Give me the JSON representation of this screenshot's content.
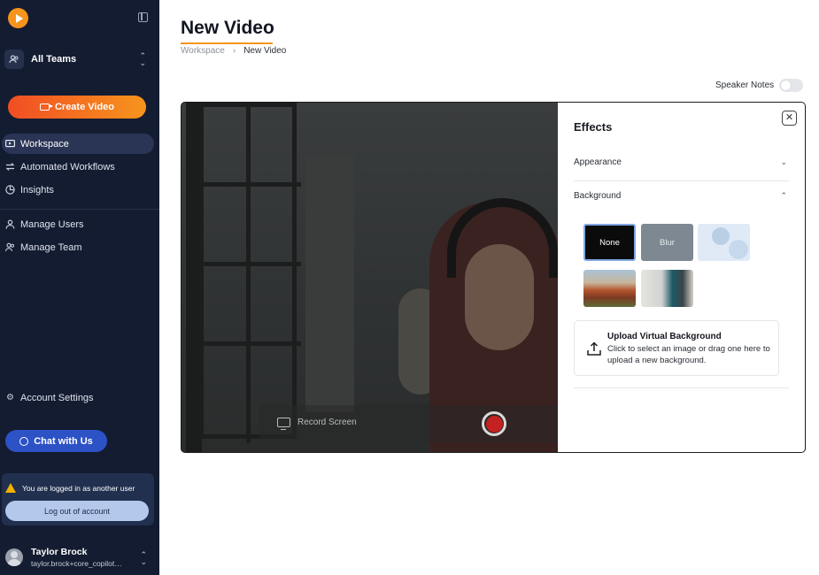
{
  "sidebar": {
    "team_selector": {
      "label": "All Teams"
    },
    "create_button": {
      "label": "Create Video"
    },
    "nav": [
      {
        "label": "Workspace",
        "icon": "workspace-icon",
        "active": true
      },
      {
        "label": "Automated Workflows",
        "icon": "workflow-icon",
        "active": false
      },
      {
        "label": "Insights",
        "icon": "insights-icon",
        "active": false
      },
      {
        "label": "Manage Users",
        "icon": "user-icon",
        "active": false
      },
      {
        "label": "Manage Team",
        "icon": "team-icon",
        "active": false
      }
    ],
    "account_settings": {
      "label": "Account Settings",
      "icon": "gear-icon"
    },
    "chat_button": {
      "label": "Chat with Us"
    },
    "warning": {
      "text": "You are logged in as another user",
      "logout_label": "Log out of account"
    },
    "user": {
      "name": "Taylor Brock",
      "email": "taylor.brock+core_copilot…"
    }
  },
  "main": {
    "title": "New Video",
    "breadcrumb": [
      "Workspace",
      "New Video"
    ],
    "speaker_notes": {
      "label": "Speaker Notes",
      "enabled": false
    },
    "recorder": {
      "record_screen_label": "Record Screen"
    },
    "effects": {
      "title": "Effects",
      "sections": [
        {
          "label": "Appearance",
          "expanded": false
        },
        {
          "label": "Background",
          "expanded": true
        }
      ],
      "backgrounds": [
        {
          "label": "None",
          "selected": true
        },
        {
          "label": "Blur",
          "selected": false
        },
        {
          "label": "",
          "kind": "pattern"
        },
        {
          "label": "",
          "kind": "rocks-photo"
        },
        {
          "label": "",
          "kind": "room-photo"
        }
      ],
      "upload": {
        "title": "Upload Virtual Background",
        "description": "Click to select an image or drag one here to upload a new background."
      }
    }
  },
  "colors": {
    "sidebar_bg": "#141c31",
    "accent_orange": "#f7941d",
    "chat_blue": "#2d52c6",
    "warning_yellow": "#f5b000",
    "record_red": "#c42222"
  }
}
